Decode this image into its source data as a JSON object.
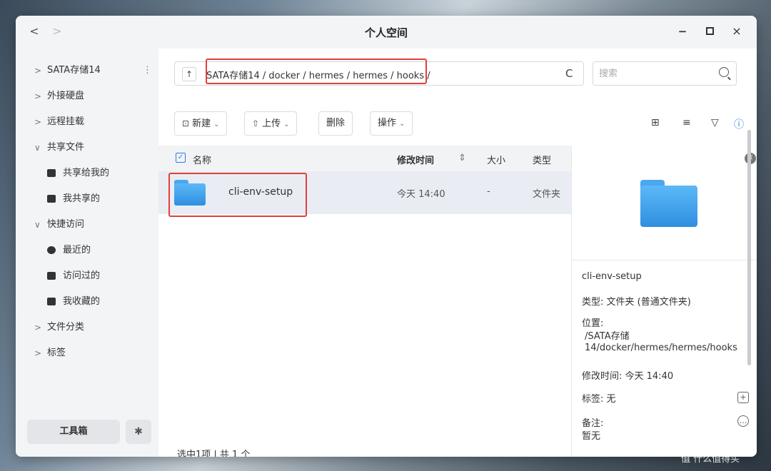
{
  "window": {
    "title": "个人空间",
    "nav_back": "<",
    "nav_forward": ">",
    "minimize_glyph": "−",
    "close_glyph": "×"
  },
  "sidebar": {
    "items": [
      {
        "label": "SATA存储14",
        "chevron": ">"
      },
      {
        "label": "外接硬盘",
        "chevron": ">"
      },
      {
        "label": "远程挂载",
        "chevron": ">"
      },
      {
        "label": "共享文件",
        "chevron": "∨"
      },
      {
        "label": "共享给我的"
      },
      {
        "label": "我共享的"
      },
      {
        "label": "快捷访问",
        "chevron": "∨"
      },
      {
        "label": "最近的"
      },
      {
        "label": "访问过的"
      },
      {
        "label": "我收藏的"
      },
      {
        "label": "文件分类",
        "chevron": ">"
      },
      {
        "label": "标签",
        "chevron": ">"
      }
    ],
    "more_glyph": "⋮",
    "toolbox_label": "工具箱",
    "settings_glyph": "✱"
  },
  "toolbar": {
    "up_glyph": "↑",
    "path": "SATA存储14 / docker / hermes / hermes / hooks /",
    "refresh_glyph": "C",
    "search_placeholder": "搜索",
    "new_label": "新建",
    "upload_label": "上传",
    "delete_label": "删除",
    "actions_label": "操作",
    "dropdown_glyph": "⌄",
    "view_icons": [
      "column-view-icon",
      "list-view-icon",
      "filter-icon",
      "info-icon"
    ],
    "view_glyphs": [
      "⊞",
      "≡",
      "▽",
      "ⓘ"
    ]
  },
  "table": {
    "check_glyph": "✓",
    "columns": {
      "name": "名称",
      "modified": "修改时间",
      "sort_glyph": "⇕",
      "size": "大小",
      "type": "类型"
    },
    "rows": [
      {
        "name": "cli-env-setup",
        "modified": "今天 14:40",
        "size": "-",
        "type": "文件夹"
      }
    ]
  },
  "status": "选中1项 | 共 1 个",
  "detail": {
    "close_glyph": "✕",
    "name": "cli-env-setup",
    "type_line": "类型: 文件夹 (普通文件夹)",
    "location_label": "位置:",
    "location_line1": "/SATA存储",
    "location_line2": "14/docker/hermes/hermes/hooks",
    "modified_line": "修改时间: 今天 14:40",
    "tags_line": "标签: 无",
    "add_tag_glyph": "+",
    "note_label": "备注:",
    "note_value": "暂无",
    "note_glyph": "…"
  },
  "watermark": "值 什么值得买",
  "colors": {
    "accent": "#2a7de1",
    "highlight_box": "#e0403a",
    "folder": "#3a9be8",
    "selected_row": "#e9edf3"
  }
}
